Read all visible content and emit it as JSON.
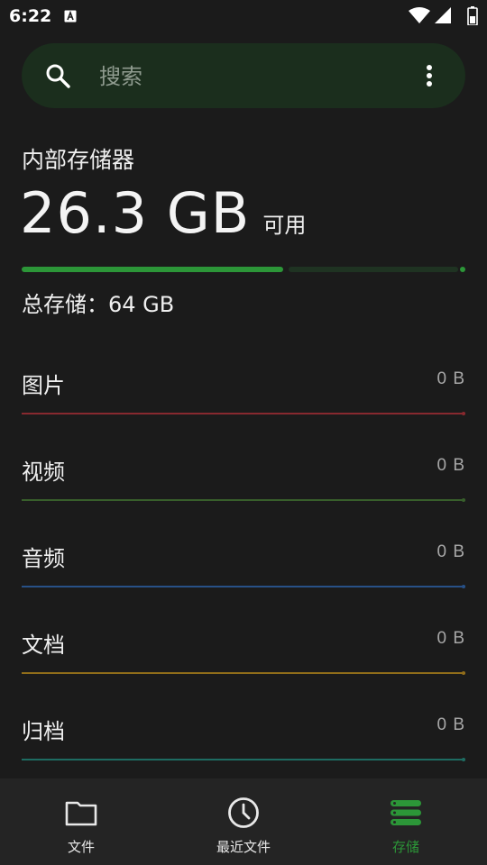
{
  "status_bar": {
    "time": "6:22"
  },
  "search": {
    "placeholder": "搜索"
  },
  "storage": {
    "title": "内部存储器",
    "free_value": "26.3 GB",
    "free_unit": "可用",
    "total_text": "总存储：64 GB",
    "used_fraction": 0.59
  },
  "categories": [
    {
      "name": "图片",
      "size": "0 B",
      "color": "#9b2c32"
    },
    {
      "name": "视频",
      "size": "0 B",
      "color": "#3d6b2e"
    },
    {
      "name": "音频",
      "size": "0 B",
      "color": "#2a5a9a"
    },
    {
      "name": "文档",
      "size": "0 B",
      "color": "#a67c1a"
    },
    {
      "name": "归档",
      "size": "0 B",
      "color": "#1f7a6e"
    }
  ],
  "nav": {
    "items": [
      {
        "label": "文件",
        "icon": "folder-icon"
      },
      {
        "label": "最近文件",
        "icon": "clock-icon"
      },
      {
        "label": "存储",
        "icon": "storage-icon"
      }
    ],
    "active_index": 2
  },
  "colors": {
    "accent": "#2c9638",
    "background": "#1b1b1b",
    "search_bg": "#1b2e1d",
    "nav_bg": "#242424"
  }
}
